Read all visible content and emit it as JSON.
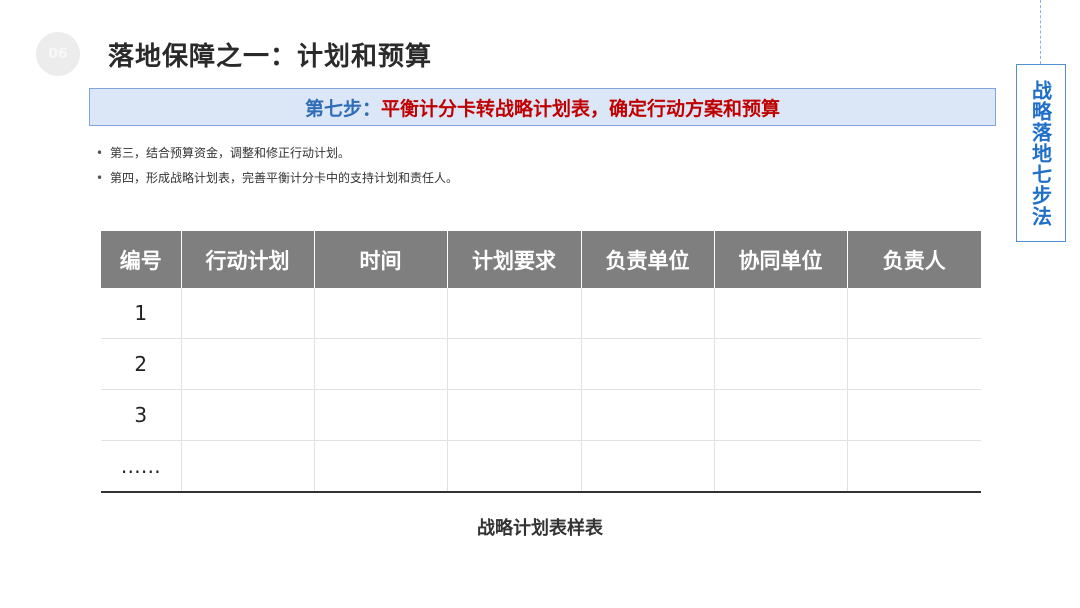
{
  "header": {
    "section_number": "06",
    "title": "落地保障之一：计划和预算"
  },
  "step_banner": {
    "prefix": "第七步：",
    "text": "平衡计分卡转战略计划表，确定行动方案和预算"
  },
  "side_title": "战略落地七步法",
  "bullets": [
    "第三，结合预算资金，调整和修正行动计划。",
    "第四，形成战略计划表，完善平衡计分卡中的支持计划和责任人。"
  ],
  "table": {
    "headers": [
      "编号",
      "行动计划",
      "时间",
      "计划要求",
      "负责单位",
      "协同单位",
      "负责人"
    ],
    "rows": [
      [
        "1",
        "",
        "",
        "",
        "",
        "",
        ""
      ],
      [
        "2",
        "",
        "",
        "",
        "",
        "",
        ""
      ],
      [
        "3",
        "",
        "",
        "",
        "",
        "",
        ""
      ],
      [
        "……",
        "",
        "",
        "",
        "",
        "",
        ""
      ]
    ]
  },
  "caption": "战略计划表样表",
  "colors": {
    "accent_blue": "#2f6db5",
    "accent_red": "#c00000",
    "header_gray": "#7f7f7f",
    "banner_bg": "#dbe6f7"
  }
}
